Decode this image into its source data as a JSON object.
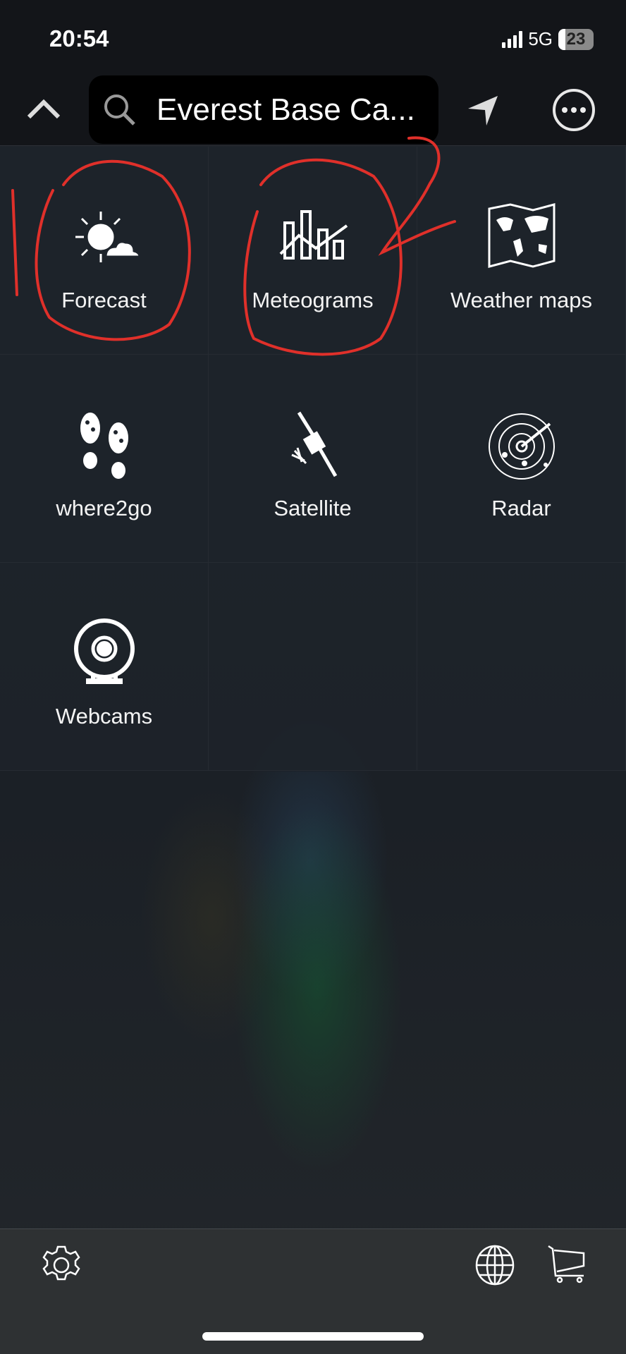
{
  "status_bar": {
    "time": "20:54",
    "network": "5G",
    "battery": "23"
  },
  "header": {
    "search_value": "Everest Base Ca...",
    "icons": [
      "chevron-up-icon",
      "search-icon",
      "location-arrow-icon",
      "more-icon"
    ]
  },
  "menu": {
    "items": [
      {
        "label": "Forecast",
        "icon": "sun-cloud-icon"
      },
      {
        "label": "Meteograms",
        "icon": "meteogram-icon"
      },
      {
        "label": "Weather maps",
        "icon": "world-map-icon"
      },
      {
        "label": "where2go",
        "icon": "footprints-icon"
      },
      {
        "label": "Satellite",
        "icon": "satellite-icon"
      },
      {
        "label": "Radar",
        "icon": "radar-icon"
      },
      {
        "label": "Webcams",
        "icon": "webcam-icon"
      }
    ]
  },
  "bottom_bar": {
    "icons": [
      "gear-icon",
      "globe-icon",
      "cart-icon"
    ]
  },
  "colors": {
    "annotation": "#e0302a",
    "background": "#1b2026"
  }
}
